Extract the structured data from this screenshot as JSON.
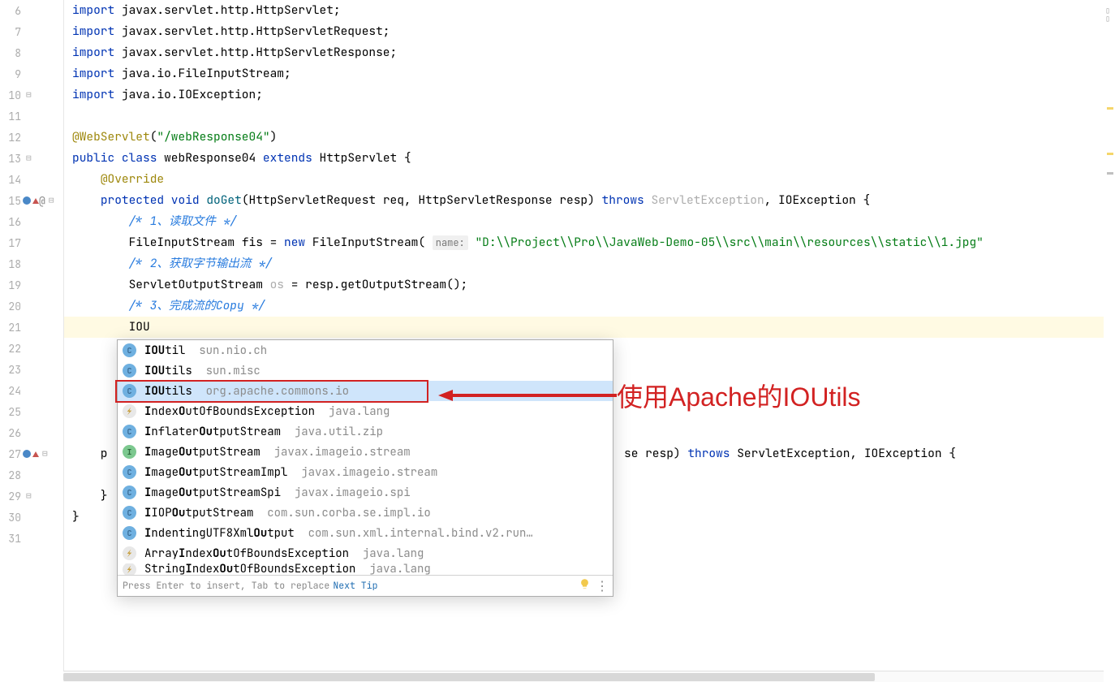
{
  "gutter": {
    "start": 6,
    "end": 31
  },
  "code": {
    "lines": {
      "6": {
        "tokens": [
          {
            "t": "import ",
            "c": "kw"
          },
          {
            "t": "javax.servlet.http.HttpServlet;",
            "c": "cls"
          }
        ]
      },
      "7": {
        "tokens": [
          {
            "t": "import ",
            "c": "kw"
          },
          {
            "t": "javax.servlet.http.HttpServletRequest;",
            "c": "cls"
          }
        ]
      },
      "8": {
        "tokens": [
          {
            "t": "import ",
            "c": "kw"
          },
          {
            "t": "javax.servlet.http.HttpServletResponse;",
            "c": "cls"
          }
        ]
      },
      "9": {
        "tokens": [
          {
            "t": "import ",
            "c": "kw"
          },
          {
            "t": "java.io.FileInputStream;",
            "c": "cls"
          }
        ]
      },
      "10": {
        "tokens": [
          {
            "t": "import ",
            "c": "kw"
          },
          {
            "t": "java.io.IOException;",
            "c": "cls"
          }
        ]
      },
      "11": {
        "tokens": []
      },
      "12": {
        "tokens": [
          {
            "t": "@WebServlet",
            "c": "anno"
          },
          {
            "t": "(",
            "c": "cls"
          },
          {
            "t": "\"/webResponse04\"",
            "c": "str"
          },
          {
            "t": ")",
            "c": "cls"
          }
        ]
      },
      "13": {
        "tokens": [
          {
            "t": "public class ",
            "c": "kw"
          },
          {
            "t": "webResponse04 ",
            "c": "cls"
          },
          {
            "t": "extends ",
            "c": "kw"
          },
          {
            "t": "HttpServlet {",
            "c": "cls"
          }
        ]
      },
      "14": {
        "tokens": [
          {
            "t": "    ",
            "c": ""
          },
          {
            "t": "@Override",
            "c": "anno"
          }
        ]
      },
      "15": {
        "tokens": [
          {
            "t": "    ",
            "c": ""
          },
          {
            "t": "protected void ",
            "c": "kw"
          },
          {
            "t": "doGet",
            "c": "method"
          },
          {
            "t": "(HttpServletRequest ",
            "c": "cls"
          },
          {
            "t": "req",
            "c": "param"
          },
          {
            "t": ", HttpServletResponse ",
            "c": "cls"
          },
          {
            "t": "resp",
            "c": "param"
          },
          {
            "t": ") ",
            "c": "cls"
          },
          {
            "t": "throws ",
            "c": "kw"
          },
          {
            "t": "ServletException",
            "c": "fold-region-gray"
          },
          {
            "t": ", IOException {",
            "c": "cls"
          }
        ]
      },
      "16": {
        "tokens": [
          {
            "t": "        ",
            "c": ""
          },
          {
            "t": "/* 1、读取文件 */",
            "c": "comment-blue"
          }
        ]
      },
      "17": {
        "tokens": [
          {
            "t": "        FileInputStream ",
            "c": "cls"
          },
          {
            "t": "fis",
            "c": "param"
          },
          {
            "t": " = ",
            "c": "cls"
          },
          {
            "t": "new ",
            "c": "kw"
          },
          {
            "t": "FileInputStream( ",
            "c": "cls"
          },
          {
            "t": "name:",
            "c": "param-hint"
          },
          {
            "t": " ",
            "c": ""
          },
          {
            "t": "\"D:\\\\Project\\\\Pro\\\\JavaWeb-Demo-05\\\\src\\\\main\\\\resources\\\\static\\\\1.jpg\"",
            "c": "str"
          }
        ]
      },
      "18": {
        "tokens": [
          {
            "t": "        ",
            "c": ""
          },
          {
            "t": "/* 2、获取字节输出流 */",
            "c": "comment-blue"
          }
        ]
      },
      "19": {
        "tokens": [
          {
            "t": "        ServletOutputStream ",
            "c": "cls"
          },
          {
            "t": "os",
            "c": "fold-region-gray"
          },
          {
            "t": " = resp.getOutputStream();",
            "c": "cls"
          }
        ]
      },
      "20": {
        "tokens": [
          {
            "t": "        ",
            "c": ""
          },
          {
            "t": "/* 3、完成流的Copy */",
            "c": "comment-blue"
          }
        ]
      },
      "21": {
        "tokens": [
          {
            "t": "        IOU",
            "c": "cls"
          }
        ],
        "hl": true
      },
      "22": {
        "tokens": []
      },
      "23": {
        "tokens": []
      },
      "24": {
        "tokens": []
      },
      "25": {
        "tokens": []
      },
      "26": {
        "tokens": []
      },
      "27": {
        "tokens": [
          {
            "t": "    p",
            "c": "cls"
          }
        ],
        "tail": {
          "tokens": [
            {
              "t": "se resp) ",
              "c": "cls"
            },
            {
              "t": "throws ",
              "c": "kw"
            },
            {
              "t": "ServletException, IOException {",
              "c": "cls"
            }
          ]
        }
      },
      "28": {
        "tokens": []
      },
      "29": {
        "tokens": [
          {
            "t": "    }",
            "c": "cls"
          }
        ]
      },
      "30": {
        "tokens": [
          {
            "t": "}",
            "c": "cls"
          }
        ]
      },
      "31": {
        "tokens": []
      }
    }
  },
  "autocomplete": {
    "items": [
      {
        "icon": "c",
        "name": "IOUtil",
        "bold": "IOU",
        "rest": "til",
        "pkg": "sun.nio.ch"
      },
      {
        "icon": "c",
        "name": "IOUtils",
        "bold": "IOU",
        "rest": "tils",
        "pkg": "sun.misc"
      },
      {
        "icon": "c",
        "name": "IOUtils",
        "bold": "IOU",
        "rest": "tils",
        "pkg": "org.apache.commons.io",
        "selected": true
      },
      {
        "icon": "e",
        "name": "IndexOutOfBoundsException",
        "bold": "",
        "rest": "IndexOutOfBoundsException",
        "pkg": "java.lang",
        "custom": [
          {
            "t": "I",
            "b": true
          },
          {
            "t": "ndex",
            "b": false
          },
          {
            "t": "O",
            "b": true
          },
          {
            "t": "ut",
            "b": false
          },
          {
            "t": "O",
            "b": false
          },
          {
            "t": "fBoundsException",
            "b": false
          }
        ]
      },
      {
        "icon": "c",
        "name": "InflaterOutputStream",
        "bold": "",
        "rest": "",
        "pkg": "java.util.zip",
        "custom": [
          {
            "t": "I",
            "b": true
          },
          {
            "t": "nflater",
            "b": false
          },
          {
            "t": "O",
            "b": true
          },
          {
            "t": "u",
            "b": true
          },
          {
            "t": "tputStream",
            "b": false
          }
        ]
      },
      {
        "icon": "i",
        "name": "ImageOutputStream",
        "bold": "",
        "rest": "",
        "pkg": "javax.imageio.stream",
        "custom": [
          {
            "t": "I",
            "b": true
          },
          {
            "t": "mage",
            "b": false
          },
          {
            "t": "O",
            "b": true
          },
          {
            "t": "u",
            "b": true
          },
          {
            "t": "tputStream",
            "b": false
          }
        ]
      },
      {
        "icon": "c",
        "name": "ImageOutputStreamImpl",
        "bold": "",
        "rest": "",
        "pkg": "javax.imageio.stream",
        "custom": [
          {
            "t": "I",
            "b": true
          },
          {
            "t": "mage",
            "b": false
          },
          {
            "t": "O",
            "b": true
          },
          {
            "t": "u",
            "b": true
          },
          {
            "t": "tputStreamImpl",
            "b": false
          }
        ]
      },
      {
        "icon": "c",
        "name": "ImageOutputStreamSpi",
        "bold": "",
        "rest": "",
        "pkg": "javax.imageio.spi",
        "custom": [
          {
            "t": "I",
            "b": true
          },
          {
            "t": "mage",
            "b": false
          },
          {
            "t": "O",
            "b": true
          },
          {
            "t": "u",
            "b": true
          },
          {
            "t": "tputStreamSpi",
            "b": false
          }
        ]
      },
      {
        "icon": "c",
        "name": "IIOPOutputStream",
        "bold": "",
        "rest": "",
        "pkg": "com.sun.corba.se.impl.io",
        "custom": [
          {
            "t": "I",
            "b": true
          },
          {
            "t": "IOP",
            "b": false
          },
          {
            "t": "O",
            "b": true
          },
          {
            "t": "u",
            "b": true
          },
          {
            "t": "tputStream",
            "b": false
          }
        ]
      },
      {
        "icon": "c",
        "name": "IndentingUTF8XmlOutput",
        "bold": "",
        "rest": "",
        "pkg": "com.sun.xml.internal.bind.v2.run…",
        "custom": [
          {
            "t": "I",
            "b": true
          },
          {
            "t": "ndentingUTF8Xml",
            "b": false
          },
          {
            "t": "O",
            "b": true
          },
          {
            "t": "u",
            "b": true
          },
          {
            "t": "tput",
            "b": false
          }
        ]
      },
      {
        "icon": "e",
        "name": "ArrayIndexOutOfBoundsException",
        "bold": "",
        "rest": "",
        "pkg": "java.lang",
        "custom": [
          {
            "t": "Array",
            "b": false
          },
          {
            "t": "I",
            "b": true
          },
          {
            "t": "ndex",
            "b": false
          },
          {
            "t": "O",
            "b": true
          },
          {
            "t": "u",
            "b": true
          },
          {
            "t": "tOfBoundsException",
            "b": false
          }
        ]
      },
      {
        "icon": "e",
        "name": "StringIndexOutOfBoundsException",
        "bold": "",
        "rest": "",
        "pkg": "java.lang",
        "custom": [
          {
            "t": "String",
            "b": false
          },
          {
            "t": "I",
            "b": true
          },
          {
            "t": "ndex",
            "b": false
          },
          {
            "t": "O",
            "b": true
          },
          {
            "t": "u",
            "b": true
          },
          {
            "t": "tOfBoundsException",
            "b": false
          }
        ],
        "cut": true
      }
    ],
    "footer": {
      "hint": "Press Enter to insert, Tab to replace",
      "next_tip": "Next Tip"
    }
  },
  "annotation": {
    "text": "使用Apache的IOUtils"
  }
}
